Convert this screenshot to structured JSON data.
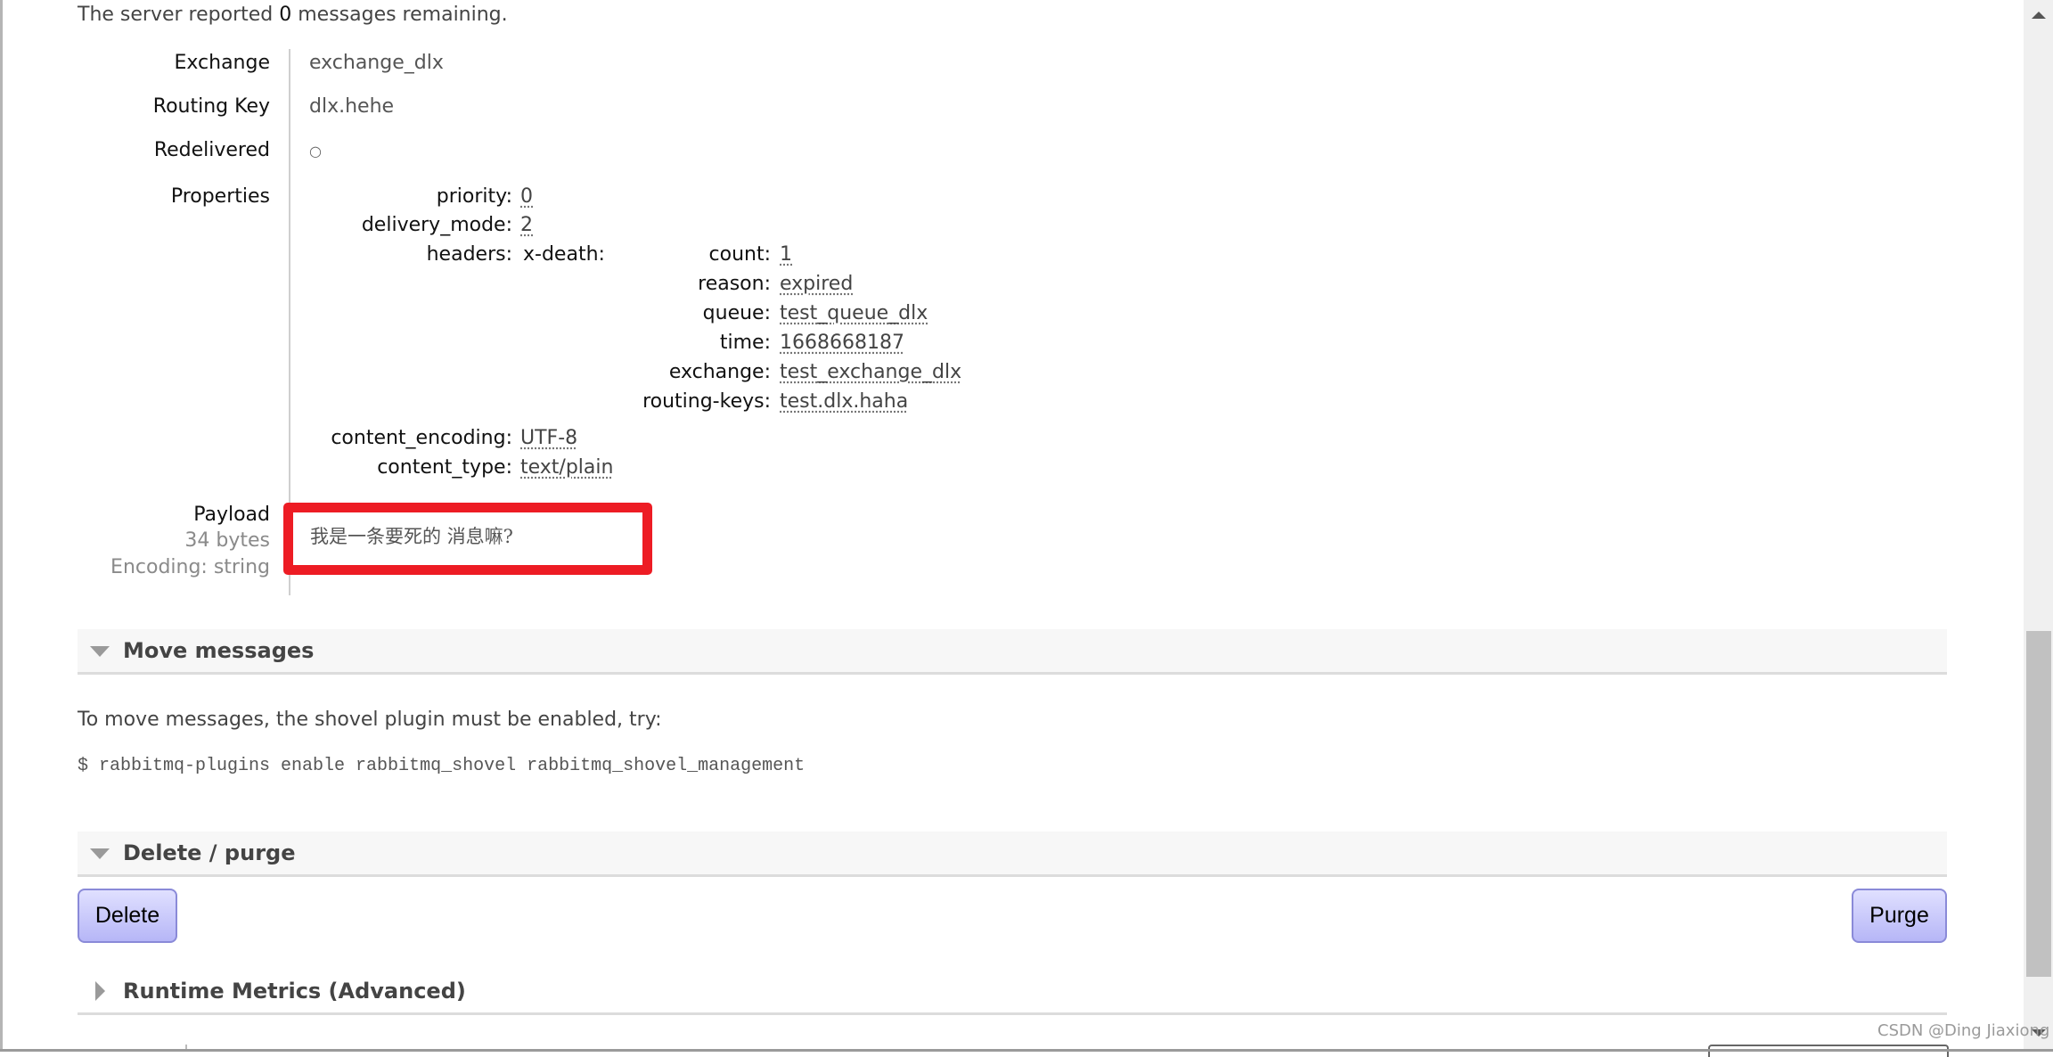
{
  "status": {
    "prefix": "The server reported ",
    "count": "0",
    "suffix": " messages remaining."
  },
  "message": {
    "fields": [
      {
        "label": "Exchange",
        "value": "exchange_dlx"
      },
      {
        "label": "Routing Key",
        "value": "dlx.hehe"
      },
      {
        "label": "Redelivered",
        "value": "○"
      }
    ],
    "properties_label": "Properties",
    "properties": {
      "priority": {
        "key": "priority:",
        "value": "0"
      },
      "delivery_mode": {
        "key": "delivery_mode:",
        "value": "2"
      },
      "headers": {
        "key": "headers:",
        "x_death_key": "x-death:",
        "x_death": [
          {
            "key": "count:",
            "value": "1"
          },
          {
            "key": "reason:",
            "value": "expired"
          },
          {
            "key": "queue:",
            "value": "test_queue_dlx"
          },
          {
            "key": "time:",
            "value": "1668668187"
          },
          {
            "key": "exchange:",
            "value": "test_exchange_dlx"
          },
          {
            "key": "routing-keys:",
            "value": "test.dlx.haha"
          }
        ]
      },
      "content_encoding": {
        "key": "content_encoding:",
        "value": "UTF-8"
      },
      "content_type": {
        "key": "content_type:",
        "value": "text/plain"
      }
    },
    "payload": {
      "label": "Payload",
      "size": "34 bytes",
      "encoding": "Encoding: string",
      "text": "我是一条要死的 消息嘛?",
      "highlight_color": "#ed1c24"
    }
  },
  "sections": {
    "move_messages": {
      "title": "Move messages",
      "description": "To move messages, the shovel plugin must be enabled, try:",
      "command": "$ rabbitmq-plugins enable rabbitmq_shovel rabbitmq_shovel_management"
    },
    "delete_purge": {
      "title": "Delete / purge",
      "delete_label": "Delete",
      "purge_label": "Purge"
    },
    "runtime_metrics": {
      "title": "Runtime Metrics (Advanced)"
    }
  },
  "watermark": "CSDN @Ding Jiaxiong",
  "colors": {
    "button_top": "#e0e0ff",
    "button_bottom": "#b6b6f7",
    "button_border": "#8a8ad8",
    "section_bg": "#f7f7f7"
  }
}
